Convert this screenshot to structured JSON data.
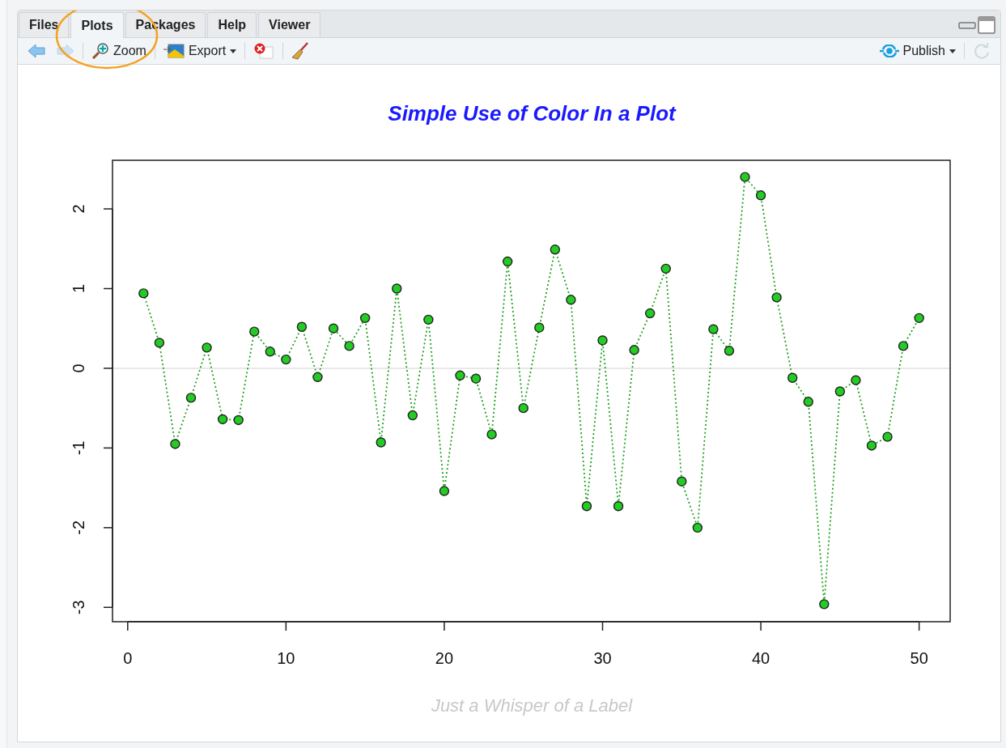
{
  "tabs": [
    {
      "label": "Files",
      "selected": false
    },
    {
      "label": "Plots",
      "selected": true
    },
    {
      "label": "Packages",
      "selected": false
    },
    {
      "label": "Help",
      "selected": false
    },
    {
      "label": "Viewer",
      "selected": false
    }
  ],
  "toolbar": [
    {
      "kind": "back",
      "disabled": false
    },
    {
      "kind": "forward",
      "disabled": true
    },
    {
      "kind": "zoom",
      "label": "Zoom",
      "disabled": false
    },
    {
      "kind": "export",
      "label": "Export",
      "disabled": false
    },
    {
      "kind": "clear",
      "disabled": false
    },
    {
      "kind": "broom",
      "disabled": false
    }
  ],
  "toolbar_right": [
    {
      "kind": "publish",
      "label": "Publish",
      "disabled": false
    },
    {
      "kind": "refresh",
      "disabled": true
    }
  ],
  "plot": {
    "chart_data": {
      "type": "line",
      "title": "Simple Use of Color In a Plot",
      "xlabel": "Just a Whisper of a Label",
      "x": [
        1,
        2,
        3,
        4,
        5,
        6,
        7,
        8,
        9,
        10,
        11,
        12,
        13,
        14,
        15,
        16,
        17,
        18,
        19,
        20,
        21,
        22,
        23,
        24,
        25,
        26,
        27,
        28,
        29,
        30,
        31,
        32,
        33,
        34,
        35,
        36,
        37,
        38,
        39,
        40,
        41,
        42,
        43,
        44,
        45,
        46,
        47,
        48,
        49,
        50
      ],
      "xlim": [
        -0.96,
        51.96
      ],
      "ylim": [
        -3.18,
        2.61
      ],
      "series": [
        {
          "color": "#22cc22",
          "line_style": "dotted",
          "marker": "circle",
          "values": [
            0.94,
            0.32,
            -0.95,
            -0.37,
            0.26,
            -0.64,
            -0.65,
            0.46,
            0.21,
            0.11,
            0.52,
            -0.11,
            0.5,
            0.28,
            0.63,
            -0.93,
            1.0,
            -0.59,
            0.61,
            -1.54,
            -0.09,
            -0.13,
            -0.83,
            1.34,
            -0.5,
            0.51,
            1.49,
            0.86,
            -1.73,
            0.35,
            -1.73,
            0.23,
            0.69,
            1.25,
            -1.42,
            -2.0,
            0.49,
            0.22,
            2.4,
            2.17,
            0.89,
            -0.12,
            -0.42,
            -2.96,
            -0.29,
            -0.15,
            -0.97,
            -0.86,
            0.28,
            0.63
          ]
        }
      ],
      "xticks": [
        0,
        10,
        20,
        30,
        40,
        50
      ],
      "yticks": [
        -3,
        -2,
        -1,
        0,
        1,
        2
      ]
    }
  }
}
